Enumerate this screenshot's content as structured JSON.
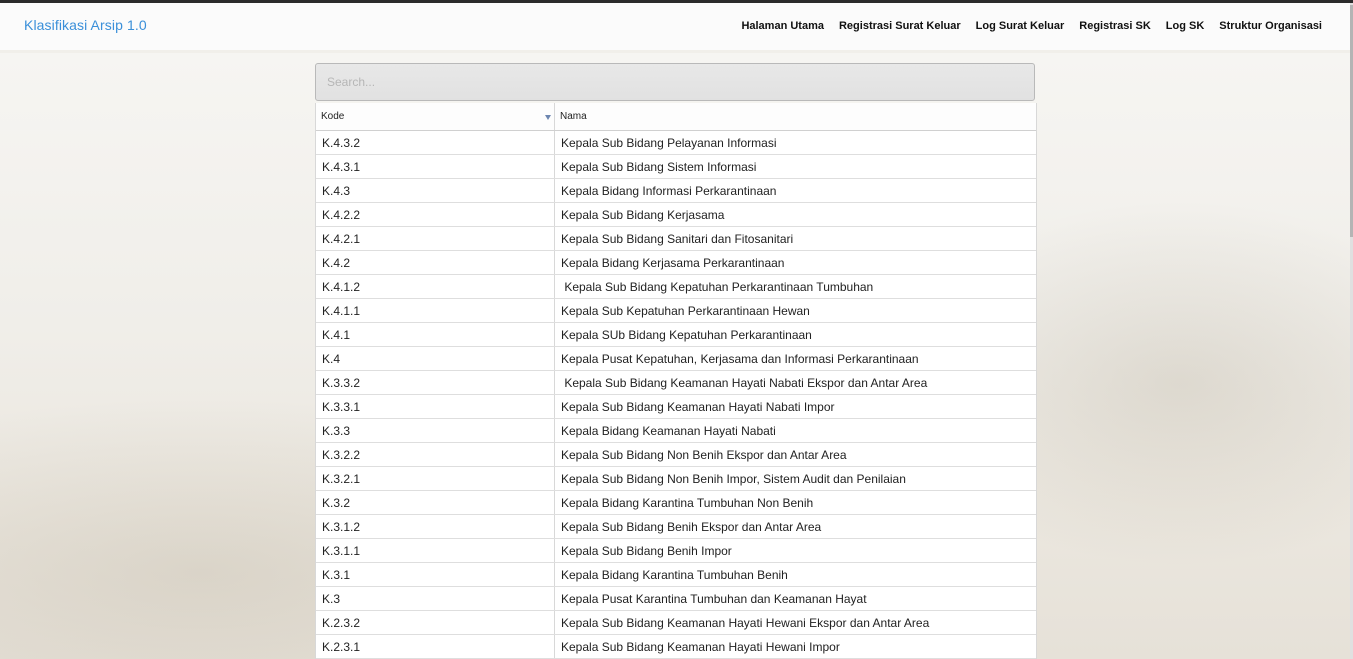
{
  "navbar": {
    "brand": "Klasifikasi Arsip 1.0",
    "links": [
      "Halaman Utama",
      "Registrasi Surat Keluar",
      "Log Surat Keluar",
      "Registrasi SK",
      "Log SK",
      "Struktur Organisasi"
    ]
  },
  "search": {
    "placeholder": "Search..."
  },
  "table": {
    "headers": {
      "kode": "Kode",
      "nama": "Nama"
    },
    "sort_icon": "sort-desc-icon",
    "rows": [
      {
        "kode": "K.4.3.2",
        "nama": "Kepala Sub Bidang Pelayanan Informasi"
      },
      {
        "kode": "K.4.3.1",
        "nama": "Kepala Sub Bidang Sistem Informasi"
      },
      {
        "kode": "K.4.3",
        "nama": "Kepala Bidang Informasi Perkarantinaan"
      },
      {
        "kode": "K.4.2.2",
        "nama": "Kepala Sub Bidang Kerjasama"
      },
      {
        "kode": "K.4.2.1",
        "nama": "Kepala Sub Bidang Sanitari dan Fitosanitari"
      },
      {
        "kode": "K.4.2",
        "nama": "Kepala Bidang Kerjasama Perkarantinaan"
      },
      {
        "kode": "K.4.1.2",
        "nama": " Kepala Sub Bidang Kepatuhan Perkarantinaan Tumbuhan"
      },
      {
        "kode": "K.4.1.1",
        "nama": "Kepala Sub Kepatuhan Perkarantinaan Hewan"
      },
      {
        "kode": "K.4.1",
        "nama": "Kepala SUb Bidang Kepatuhan Perkarantinaan"
      },
      {
        "kode": "K.4",
        "nama": "Kepala Pusat Kepatuhan, Kerjasama dan Informasi Perkarantinaan"
      },
      {
        "kode": "K.3.3.2",
        "nama": " Kepala Sub Bidang Keamanan Hayati Nabati Ekspor dan Antar Area"
      },
      {
        "kode": "K.3.3.1",
        "nama": "Kepala Sub Bidang Keamanan Hayati Nabati Impor"
      },
      {
        "kode": "K.3.3",
        "nama": "Kepala Bidang Keamanan Hayati Nabati"
      },
      {
        "kode": "K.3.2.2",
        "nama": "Kepala Sub Bidang Non Benih Ekspor dan Antar Area"
      },
      {
        "kode": "K.3.2.1",
        "nama": "Kepala Sub Bidang Non Benih Impor, Sistem Audit dan Penilaian"
      },
      {
        "kode": "K.3.2",
        "nama": "Kepala Bidang Karantina Tumbuhan Non Benih"
      },
      {
        "kode": "K.3.1.2",
        "nama": "Kepala Sub Bidang Benih Ekspor dan Antar Area"
      },
      {
        "kode": "K.3.1.1",
        "nama": "Kepala Sub Bidang Benih Impor"
      },
      {
        "kode": "K.3.1",
        "nama": "Kepala Bidang Karantina Tumbuhan Benih"
      },
      {
        "kode": "K.3",
        "nama": "Kepala Pusat Karantina Tumbuhan dan Keamanan Hayat"
      },
      {
        "kode": "K.2.3.2",
        "nama": "Kepala Sub Bidang Keamanan Hayati Hewani Ekspor dan Antar Area"
      },
      {
        "kode": "K.2.3.1",
        "nama": "Kepala Sub Bidang Keamanan Hayati Hewani Impor"
      }
    ]
  },
  "colors": {
    "brand": "#3a8fd9",
    "sort_arrow": "#6d86b0"
  }
}
